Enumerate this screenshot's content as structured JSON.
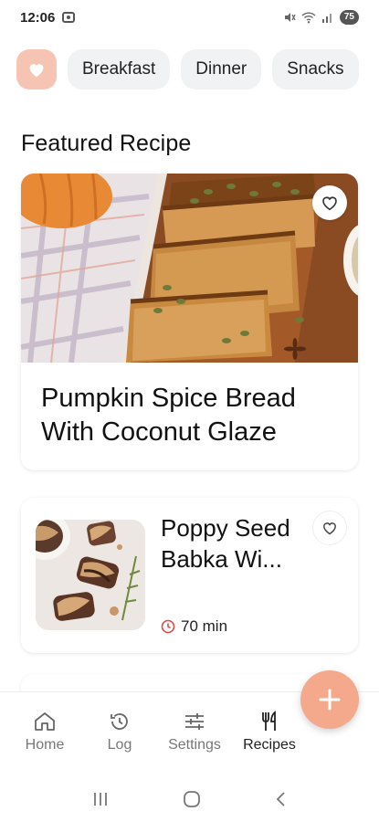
{
  "status_bar": {
    "time": "12:06",
    "battery": "75"
  },
  "categories": [
    {
      "label": "Breakfast"
    },
    {
      "label": "Dinner"
    },
    {
      "label": "Snacks"
    }
  ],
  "featured": {
    "section_title": "Featured Recipe",
    "title": "Pumpkin Spice Bread With Coconut Glaze"
  },
  "recipes": [
    {
      "title": "Poppy Seed Babka Wi...",
      "time": "70 min"
    }
  ],
  "nav": [
    {
      "label": "Home",
      "icon": "home-icon"
    },
    {
      "label": "Log",
      "icon": "history-icon"
    },
    {
      "label": "Settings",
      "icon": "sliders-icon"
    },
    {
      "label": "Recipes",
      "icon": "fork-knife-icon"
    }
  ],
  "colors": {
    "accent": "#f5a98c",
    "chip_fav": "#f6c4b3",
    "chip_bg": "#f1f2f3",
    "clock_red": "#e04848"
  }
}
